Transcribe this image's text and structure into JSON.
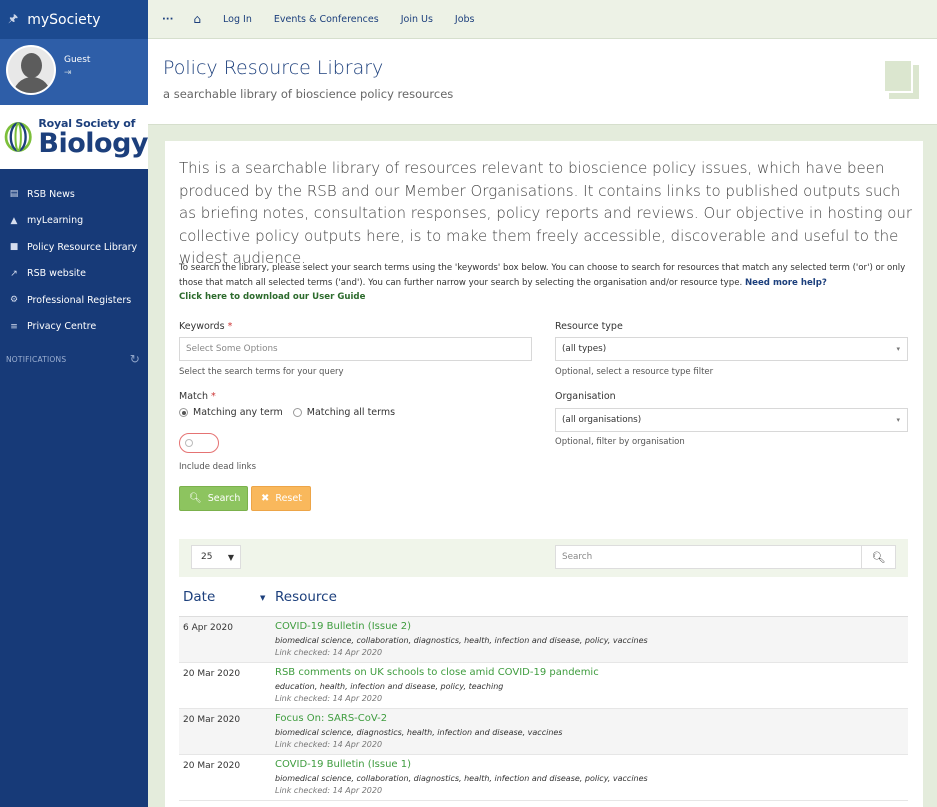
{
  "sidebar": {
    "brand": "mySociety",
    "user": {
      "name": "Guest"
    },
    "logo": {
      "line1": "Royal Society of",
      "line2": "Biology"
    },
    "items": [
      {
        "label": "RSB News",
        "icon": "newspaper-icon"
      },
      {
        "label": "myLearning",
        "icon": "graduation-cap-icon"
      },
      {
        "label": "Policy Resource Library",
        "icon": "book-icon"
      },
      {
        "label": "RSB website",
        "icon": "external-link-icon"
      },
      {
        "label": "Professional Registers",
        "icon": "cog-icon"
      },
      {
        "label": "Privacy Centre",
        "icon": "sliders-icon"
      }
    ],
    "notifications_label": "NOTIFICATIONS"
  },
  "topbar": {
    "links": [
      "Log In",
      "Events & Conferences",
      "Join Us",
      "Jobs"
    ]
  },
  "header": {
    "title": "Policy Resource Library",
    "subtitle": "a searchable library of bioscience policy resources"
  },
  "main": {
    "intro": "This is a searchable library of resources relevant to bioscience policy issues, which have been produced by the RSB and our Member Organisations. It contains links to published outputs such as briefing notes, consultation responses, policy reports and reviews. Our objective in hosting our collective policy outputs here, is to make them freely accessible, discoverable and useful to the widest audience.",
    "instructions": "To search the library, please select your search terms using the 'keywords' box below. You can choose to search for resources that match any selected term ('or') or only those that match all selected terms ('and'). You can further narrow your search by selecting the organisation and/or resource type.",
    "help_link": "Need more help?",
    "guide_link": "Click here to download our User Guide"
  },
  "form": {
    "keywords_label": "Keywords",
    "required_mark": "*",
    "keywords_placeholder": "Select Some Options",
    "keywords_hint": "Select the search terms for your query",
    "match_label": "Match",
    "match_any": "Matching any term",
    "match_all": "Matching all terms",
    "dead_links_label": "Include dead links",
    "resource_type_label": "Resource type",
    "resource_type_value": "(all types)",
    "resource_type_hint": "Optional, select a resource type filter",
    "organisation_label": "Organisation",
    "organisation_value": "(all organisations)",
    "organisation_hint": "Optional, filter by organisation",
    "search_button": "Search",
    "reset_button": "Reset"
  },
  "table": {
    "page_size": "25",
    "search_placeholder": "Search",
    "col_date": "Date",
    "col_resource": "Resource",
    "rows": [
      {
        "date": "6 Apr 2020",
        "title": "COVID-19 Bulletin (Issue 2)",
        "tags": "biomedical science, collaboration, diagnostics, health, infection and disease, policy, vaccines",
        "checked": "Link checked: 14 Apr 2020"
      },
      {
        "date": "20 Mar 2020",
        "title": "RSB comments on UK schools to close amid COVID-19 pandemic",
        "tags": "education, health, infection and disease, policy, teaching",
        "checked": "Link checked: 14 Apr 2020"
      },
      {
        "date": "20 Mar 2020",
        "title": "Focus On: SARS-CoV-2",
        "tags": "biomedical science, diagnostics, health, infection and disease, vaccines",
        "checked": "Link checked: 14 Apr 2020"
      },
      {
        "date": "20 Mar 2020",
        "title": "COVID-19 Bulletin (Issue 1)",
        "tags": "biomedical science, collaboration, diagnostics, health, infection and disease, policy, vaccines",
        "checked": "Link checked: 14 Apr 2020"
      }
    ]
  }
}
